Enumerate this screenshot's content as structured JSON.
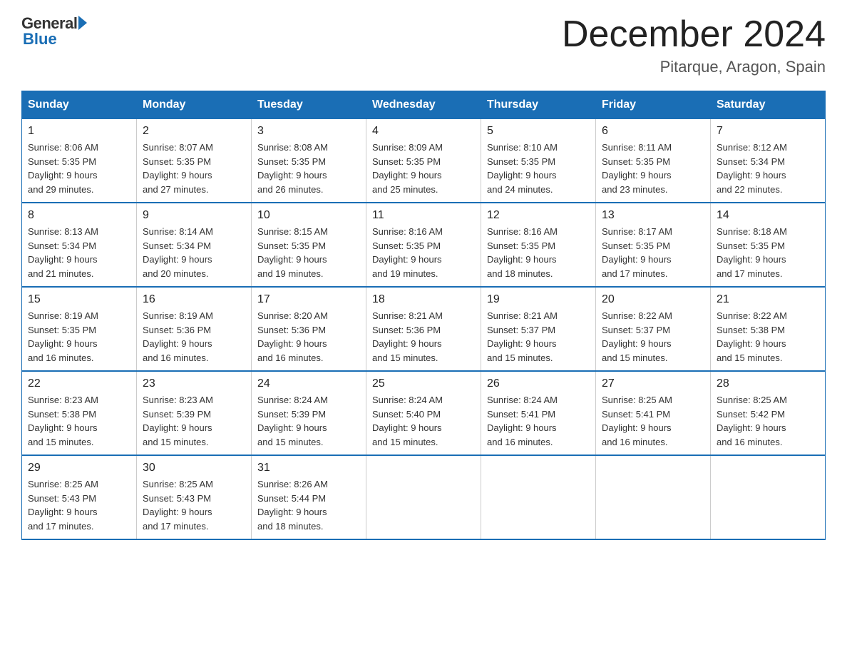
{
  "header": {
    "logo_general": "General",
    "logo_blue": "Blue",
    "month_title": "December 2024",
    "location": "Pitarque, Aragon, Spain"
  },
  "days_of_week": [
    "Sunday",
    "Monday",
    "Tuesday",
    "Wednesday",
    "Thursday",
    "Friday",
    "Saturday"
  ],
  "weeks": [
    [
      {
        "day": "1",
        "sunrise": "8:06 AM",
        "sunset": "5:35 PM",
        "daylight": "9 hours and 29 minutes."
      },
      {
        "day": "2",
        "sunrise": "8:07 AM",
        "sunset": "5:35 PM",
        "daylight": "9 hours and 27 minutes."
      },
      {
        "day": "3",
        "sunrise": "8:08 AM",
        "sunset": "5:35 PM",
        "daylight": "9 hours and 26 minutes."
      },
      {
        "day": "4",
        "sunrise": "8:09 AM",
        "sunset": "5:35 PM",
        "daylight": "9 hours and 25 minutes."
      },
      {
        "day": "5",
        "sunrise": "8:10 AM",
        "sunset": "5:35 PM",
        "daylight": "9 hours and 24 minutes."
      },
      {
        "day": "6",
        "sunrise": "8:11 AM",
        "sunset": "5:35 PM",
        "daylight": "9 hours and 23 minutes."
      },
      {
        "day": "7",
        "sunrise": "8:12 AM",
        "sunset": "5:34 PM",
        "daylight": "9 hours and 22 minutes."
      }
    ],
    [
      {
        "day": "8",
        "sunrise": "8:13 AM",
        "sunset": "5:34 PM",
        "daylight": "9 hours and 21 minutes."
      },
      {
        "day": "9",
        "sunrise": "8:14 AM",
        "sunset": "5:34 PM",
        "daylight": "9 hours and 20 minutes."
      },
      {
        "day": "10",
        "sunrise": "8:15 AM",
        "sunset": "5:35 PM",
        "daylight": "9 hours and 19 minutes."
      },
      {
        "day": "11",
        "sunrise": "8:16 AM",
        "sunset": "5:35 PM",
        "daylight": "9 hours and 19 minutes."
      },
      {
        "day": "12",
        "sunrise": "8:16 AM",
        "sunset": "5:35 PM",
        "daylight": "9 hours and 18 minutes."
      },
      {
        "day": "13",
        "sunrise": "8:17 AM",
        "sunset": "5:35 PM",
        "daylight": "9 hours and 17 minutes."
      },
      {
        "day": "14",
        "sunrise": "8:18 AM",
        "sunset": "5:35 PM",
        "daylight": "9 hours and 17 minutes."
      }
    ],
    [
      {
        "day": "15",
        "sunrise": "8:19 AM",
        "sunset": "5:35 PM",
        "daylight": "9 hours and 16 minutes."
      },
      {
        "day": "16",
        "sunrise": "8:19 AM",
        "sunset": "5:36 PM",
        "daylight": "9 hours and 16 minutes."
      },
      {
        "day": "17",
        "sunrise": "8:20 AM",
        "sunset": "5:36 PM",
        "daylight": "9 hours and 16 minutes."
      },
      {
        "day": "18",
        "sunrise": "8:21 AM",
        "sunset": "5:36 PM",
        "daylight": "9 hours and 15 minutes."
      },
      {
        "day": "19",
        "sunrise": "8:21 AM",
        "sunset": "5:37 PM",
        "daylight": "9 hours and 15 minutes."
      },
      {
        "day": "20",
        "sunrise": "8:22 AM",
        "sunset": "5:37 PM",
        "daylight": "9 hours and 15 minutes."
      },
      {
        "day": "21",
        "sunrise": "8:22 AM",
        "sunset": "5:38 PM",
        "daylight": "9 hours and 15 minutes."
      }
    ],
    [
      {
        "day": "22",
        "sunrise": "8:23 AM",
        "sunset": "5:38 PM",
        "daylight": "9 hours and 15 minutes."
      },
      {
        "day": "23",
        "sunrise": "8:23 AM",
        "sunset": "5:39 PM",
        "daylight": "9 hours and 15 minutes."
      },
      {
        "day": "24",
        "sunrise": "8:24 AM",
        "sunset": "5:39 PM",
        "daylight": "9 hours and 15 minutes."
      },
      {
        "day": "25",
        "sunrise": "8:24 AM",
        "sunset": "5:40 PM",
        "daylight": "9 hours and 15 minutes."
      },
      {
        "day": "26",
        "sunrise": "8:24 AM",
        "sunset": "5:41 PM",
        "daylight": "9 hours and 16 minutes."
      },
      {
        "day": "27",
        "sunrise": "8:25 AM",
        "sunset": "5:41 PM",
        "daylight": "9 hours and 16 minutes."
      },
      {
        "day": "28",
        "sunrise": "8:25 AM",
        "sunset": "5:42 PM",
        "daylight": "9 hours and 16 minutes."
      }
    ],
    [
      {
        "day": "29",
        "sunrise": "8:25 AM",
        "sunset": "5:43 PM",
        "daylight": "9 hours and 17 minutes."
      },
      {
        "day": "30",
        "sunrise": "8:25 AM",
        "sunset": "5:43 PM",
        "daylight": "9 hours and 17 minutes."
      },
      {
        "day": "31",
        "sunrise": "8:26 AM",
        "sunset": "5:44 PM",
        "daylight": "9 hours and 18 minutes."
      },
      null,
      null,
      null,
      null
    ]
  ]
}
